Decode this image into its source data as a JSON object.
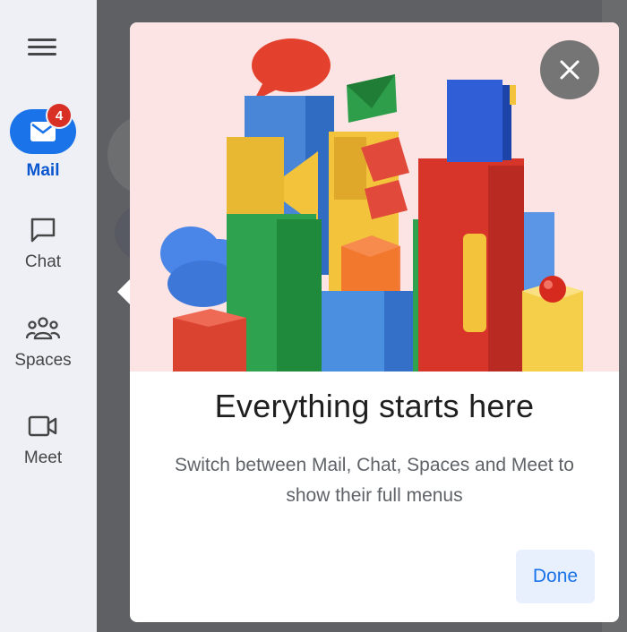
{
  "nav": {
    "menu_icon": "hamburger-menu-icon",
    "items": [
      {
        "label": "Mail",
        "icon": "mail-icon",
        "badge": "4",
        "active": true
      },
      {
        "label": "Chat",
        "icon": "chat-icon"
      },
      {
        "label": "Spaces",
        "icon": "spaces-icon"
      },
      {
        "label": "Meet",
        "icon": "video-camera-icon"
      }
    ]
  },
  "dialog": {
    "title": "Everything starts here",
    "description": "Switch between Mail, Chat, Spaces and Meet to show their full menus",
    "done_label": "Done",
    "close_icon": "close-icon",
    "illustration": "colorful-blocks-city-illustration"
  },
  "colors": {
    "accent_blue": "#1a73e8",
    "badge_red": "#d93025",
    "hero_background": "#fde4e4",
    "overlay_grey": "#5f6063"
  }
}
